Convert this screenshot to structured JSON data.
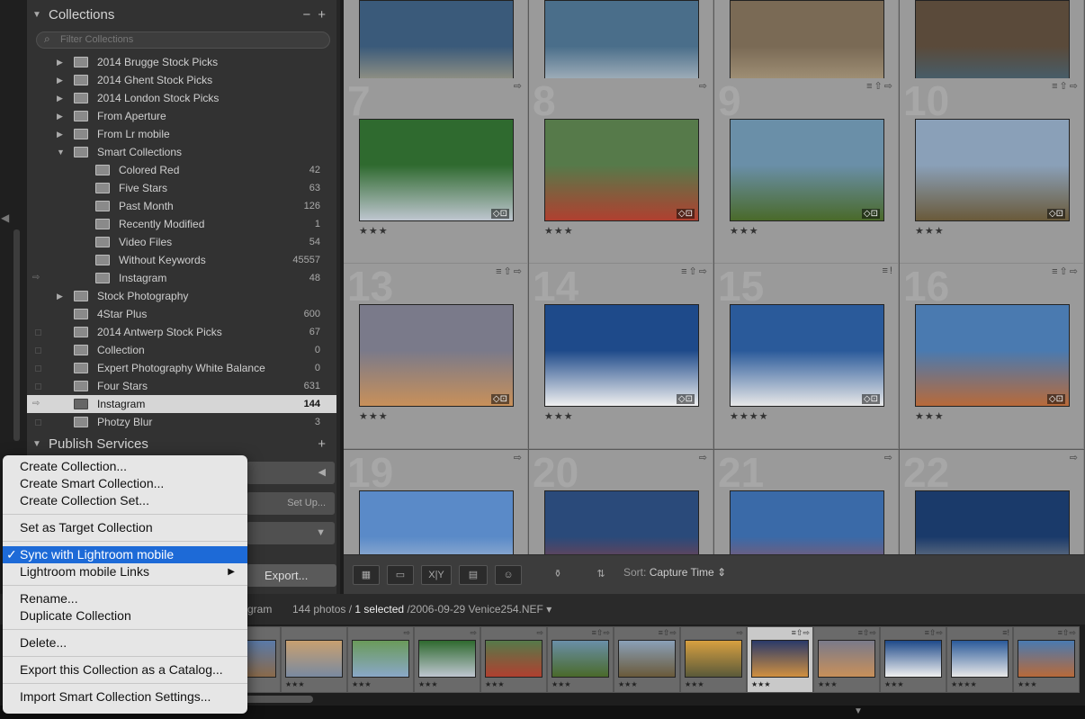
{
  "collections_panel": {
    "title": "Collections",
    "filter_placeholder": "Filter Collections",
    "items": [
      {
        "name": "2014 Brugge Stock Picks",
        "count": "",
        "level": 1,
        "expander": "▶",
        "selected": false
      },
      {
        "name": "2014 Ghent Stock Picks",
        "count": "",
        "level": 1,
        "expander": "▶",
        "selected": false
      },
      {
        "name": "2014 London Stock Picks",
        "count": "",
        "level": 1,
        "expander": "▶",
        "selected": false
      },
      {
        "name": "From Aperture",
        "count": "",
        "level": 1,
        "expander": "▶",
        "selected": false
      },
      {
        "name": "From Lr mobile",
        "count": "",
        "level": 1,
        "expander": "▶",
        "selected": false
      },
      {
        "name": "Smart Collections",
        "count": "",
        "level": 1,
        "expander": "▼",
        "selected": false
      },
      {
        "name": "Colored Red",
        "count": "42",
        "level": 2,
        "expander": "",
        "selected": false
      },
      {
        "name": "Five Stars",
        "count": "63",
        "level": 2,
        "expander": "",
        "selected": false
      },
      {
        "name": "Past Month",
        "count": "126",
        "level": 2,
        "expander": "",
        "selected": false
      },
      {
        "name": "Recently Modified",
        "count": "1",
        "level": 2,
        "expander": "",
        "selected": false
      },
      {
        "name": "Video Files",
        "count": "54",
        "level": 2,
        "expander": "",
        "selected": false
      },
      {
        "name": "Without Keywords",
        "count": "45557",
        "level": 2,
        "expander": "",
        "selected": false
      },
      {
        "name": "Instagram",
        "count": "48",
        "level": 2,
        "expander": "",
        "selected": false,
        "sync": true
      },
      {
        "name": "Stock Photography",
        "count": "",
        "level": 1,
        "expander": "▶",
        "selected": false
      },
      {
        "name": "4Star Plus",
        "count": "600",
        "level": 1,
        "expander": "",
        "selected": false
      },
      {
        "name": "2014 Antwerp Stock Picks",
        "count": "67",
        "level": 1,
        "expander": "",
        "selected": false,
        "checkbox": true
      },
      {
        "name": "Collection",
        "count": "0",
        "level": 1,
        "expander": "",
        "selected": false,
        "checkbox": true
      },
      {
        "name": "Expert Photography White Balance",
        "count": "0",
        "level": 1,
        "expander": "",
        "selected": false,
        "checkbox": true
      },
      {
        "name": "Four Stars",
        "count": "631",
        "level": 1,
        "expander": "",
        "selected": false,
        "checkbox": true
      },
      {
        "name": "Instagram",
        "count": "144",
        "level": 1,
        "expander": "",
        "selected": true,
        "sync": true
      },
      {
        "name": "Photzy Blur",
        "count": "3",
        "level": 1,
        "expander": "",
        "selected": false,
        "checkbox": true
      }
    ]
  },
  "publish_panel": {
    "title": "Publish Services",
    "setup_label": "Set Up...",
    "export_label": "Export..."
  },
  "grid": {
    "cells": [
      {
        "num": "",
        "stars": "★★★",
        "badges": "",
        "colors": [
          "#3a5a7a",
          "#c9b48a"
        ]
      },
      {
        "num": "",
        "stars": "★★★★",
        "badges": "",
        "colors": [
          "#4a6e8a",
          "#d8d8d8"
        ]
      },
      {
        "num": "",
        "stars": "★★★",
        "badges": "",
        "colors": [
          "#7a6a55",
          "#b8a88a"
        ]
      },
      {
        "num": "",
        "stars": "★★★",
        "badges": "",
        "colors": [
          "#5a4a3a",
          "#3a6a8a"
        ]
      },
      {
        "num": "7",
        "stars": "★★★",
        "badges": "⇨",
        "colors": [
          "#2f6a2f",
          "#bfc6d0"
        ]
      },
      {
        "num": "8",
        "stars": "★★★",
        "badges": "⇨",
        "colors": [
          "#567a4a",
          "#b04030"
        ]
      },
      {
        "num": "9",
        "stars": "★★★",
        "badges": "≡⇧⇨",
        "colors": [
          "#6a8fa8",
          "#4a6a2a"
        ]
      },
      {
        "num": "10",
        "stars": "★★★",
        "badges": "≡⇧⇨",
        "colors": [
          "#8aa0b8",
          "#6a5a3a"
        ]
      },
      {
        "num": "13",
        "stars": "★★★",
        "badges": "≡⇧⇨",
        "colors": [
          "#7a7a8a",
          "#c8905a"
        ]
      },
      {
        "num": "14",
        "stars": "★★★",
        "badges": "≡⇧⇨",
        "colors": [
          "#1e4a8a",
          "#f0f0f0"
        ]
      },
      {
        "num": "15",
        "stars": "★★★★",
        "badges": "≡!",
        "colors": [
          "#2a5a9a",
          "#e8e8e8"
        ]
      },
      {
        "num": "16",
        "stars": "★★★",
        "badges": "≡⇧⇨",
        "colors": [
          "#4a7ab0",
          "#b86a3a"
        ]
      },
      {
        "num": "19",
        "stars": "",
        "badges": "⇨",
        "colors": [
          "#5a8ac8",
          "#dadada"
        ]
      },
      {
        "num": "20",
        "stars": "",
        "badges": "⇨",
        "colors": [
          "#2a4a7a",
          "#c03a2a"
        ]
      },
      {
        "num": "21",
        "stars": "",
        "badges": "⇨",
        "colors": [
          "#3a6aa8",
          "#c84a3a"
        ]
      },
      {
        "num": "22",
        "stars": "",
        "badges": "⇨",
        "colors": [
          "#1a3a6a",
          "#c8b8a0"
        ]
      }
    ]
  },
  "toolbar": {
    "sort_label": "Sort:",
    "sort_value": "Capture Time"
  },
  "filmbar": {
    "source_fragment": "gram",
    "count_text": "144 photos /",
    "selected_text": "1 selected",
    "filename_text": "/2006-09-29 Venice254.NEF"
  },
  "filmstrip": {
    "frames": [
      {
        "stars": "",
        "badges": "",
        "colors": [
          "#5a7aa8",
          "#8a6a4a"
        ]
      },
      {
        "stars": "★★★",
        "badges": "",
        "colors": [
          "#c8a070",
          "#7a8aa0"
        ]
      },
      {
        "stars": "★★★",
        "badges": "⇨",
        "colors": [
          "#6a9a5a",
          "#8aa8c8"
        ]
      },
      {
        "stars": "★★★",
        "badges": "⇨",
        "colors": [
          "#2f6a2f",
          "#bfc6d0"
        ]
      },
      {
        "stars": "★★★",
        "badges": "⇨",
        "colors": [
          "#567a4a",
          "#b04030"
        ]
      },
      {
        "stars": "★★★",
        "badges": "≡⇧⇨",
        "colors": [
          "#6a8fa8",
          "#4a6a2a"
        ]
      },
      {
        "stars": "★★★",
        "badges": "≡⇧⇨",
        "colors": [
          "#8aa0b8",
          "#6a5a3a"
        ]
      },
      {
        "stars": "★★★",
        "badges": "⇨",
        "colors": [
          "#d8a040",
          "#5a5a3a"
        ]
      },
      {
        "stars": "★★★",
        "badges": "≡⇧⇨",
        "colors": [
          "#2a3a6a",
          "#d09040"
        ]
      },
      {
        "stars": "★★★",
        "badges": "≡⇧⇨",
        "colors": [
          "#7a7a8a",
          "#c8905a"
        ]
      },
      {
        "stars": "★★★",
        "badges": "≡⇧⇨",
        "colors": [
          "#1e4a8a",
          "#f0f0f0"
        ]
      },
      {
        "stars": "★★★★",
        "badges": "≡!",
        "colors": [
          "#2a5a9a",
          "#e8e8e8"
        ]
      },
      {
        "stars": "★★★",
        "badges": "≡⇧⇨",
        "colors": [
          "#4a7ab0",
          "#b86a3a"
        ]
      }
    ]
  },
  "context_menu": {
    "groups": [
      [
        {
          "label": "Create Collection..."
        },
        {
          "label": "Create Smart Collection..."
        },
        {
          "label": "Create Collection Set..."
        }
      ],
      [
        {
          "label": "Set as Target Collection"
        }
      ],
      [
        {
          "label": "Sync with Lightroom mobile",
          "checked": "✓",
          "highlighted": true
        },
        {
          "label": "Lightroom mobile Links",
          "submenu": "▶"
        }
      ],
      [
        {
          "label": "Rename..."
        },
        {
          "label": "Duplicate Collection"
        }
      ],
      [
        {
          "label": "Delete..."
        }
      ],
      [
        {
          "label": "Export this Collection as a Catalog..."
        }
      ],
      [
        {
          "label": "Import Smart Collection Settings..."
        }
      ]
    ]
  },
  "colors": {
    "panel_bg": "#323232",
    "grid_bg": "#9a9a9a",
    "menu_highlight": "#1d6ad7",
    "selected_row": "#d6d6d6"
  }
}
